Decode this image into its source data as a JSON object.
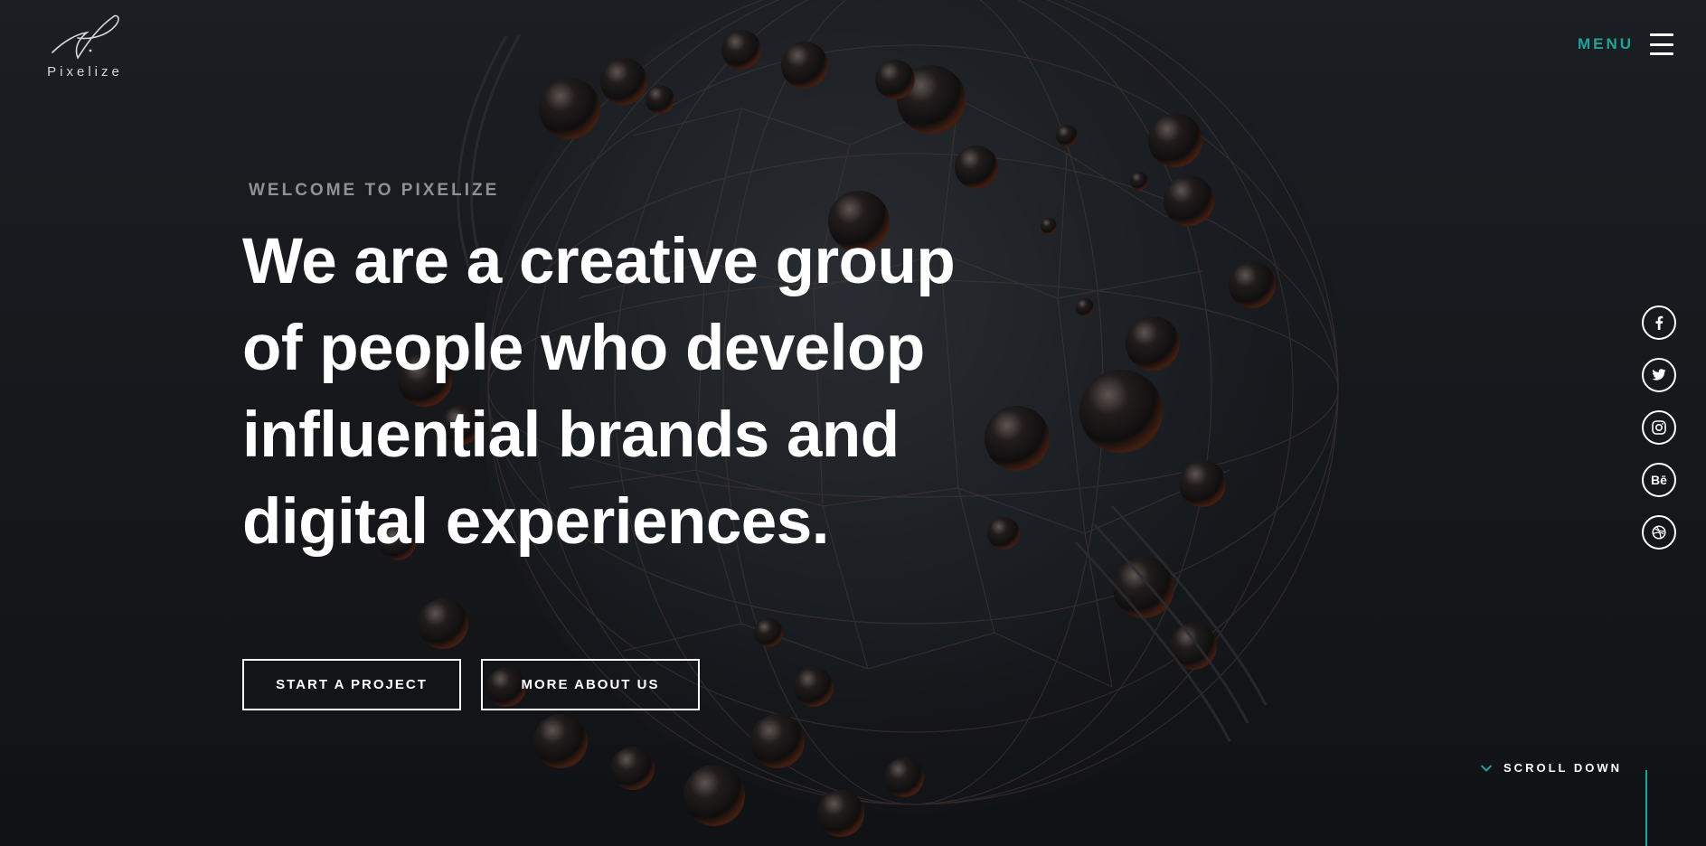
{
  "brand": {
    "name": "Pixelize",
    "logo_icon": "signature-logo-icon"
  },
  "header": {
    "menu_label": "MENU",
    "menu_icon": "hamburger-icon"
  },
  "hero": {
    "eyebrow": "WELCOME TO PIXELIZE",
    "headline_lines": [
      "We are a creative group",
      "of people who develop",
      "influential brands and",
      "digital experiences."
    ],
    "buttons": {
      "primary": "START A PROJECT",
      "secondary": "MORE ABOUT US"
    }
  },
  "social": [
    {
      "name": "facebook-icon",
      "glyph": "f"
    },
    {
      "name": "twitter-icon",
      "glyph": "twitter"
    },
    {
      "name": "instagram-icon",
      "glyph": "instagram"
    },
    {
      "name": "behance-icon",
      "glyph": "Bē"
    },
    {
      "name": "dribbble-icon",
      "glyph": "dribbble"
    }
  ],
  "scroll": {
    "label": "SCROLL DOWN",
    "icon": "chevron-down-icon"
  },
  "colors": {
    "accent": "#1fa39a",
    "background": "#17191d",
    "text": "#ffffff",
    "muted": "#8e9196"
  }
}
